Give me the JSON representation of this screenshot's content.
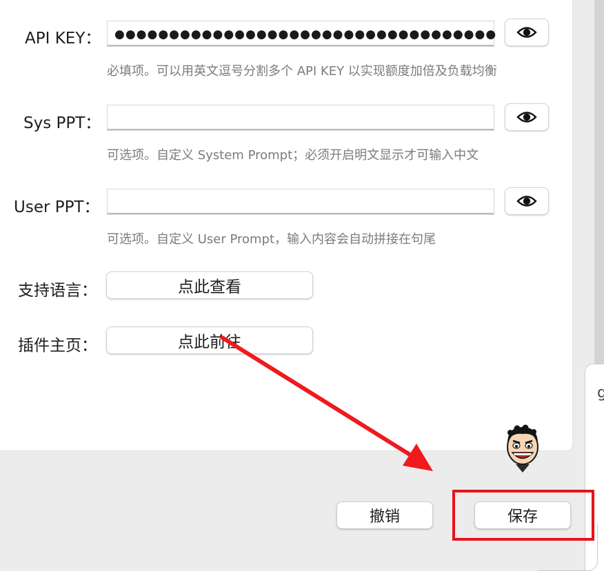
{
  "form": {
    "api_key": {
      "label": "API KEY：",
      "value": "●●●●●●●●●●●●●●●●●●●●●●●●●●●●●●●●●●●",
      "hint": "必填项。可以用英文逗号分割多个 API KEY 以实现额度加倍及负载均衡",
      "toggle_icon": "eye-icon"
    },
    "sys_ppt": {
      "label": "Sys PPT：",
      "value": "",
      "hint": "可选项。自定义 System Prompt；必须开启明文显示才可输入中文",
      "toggle_icon": "eye-icon"
    },
    "user_ppt": {
      "label": "User PPT：",
      "value": "",
      "hint": "可选项。自定义 User Prompt，输入内容会自动拼接在句尾",
      "toggle_icon": "eye-icon"
    },
    "languages": {
      "label": "支持语言：",
      "button": "点此查看"
    },
    "homepage": {
      "label": "插件主页：",
      "button": "点此前往"
    }
  },
  "footer": {
    "cancel_label": "撤销",
    "save_label": "保存"
  },
  "background": {
    "peek_text": "g"
  },
  "colors": {
    "highlight": "#e6141a",
    "arrow": "#ee1a1d",
    "panel": "#ffffff",
    "window_bg": "#ececec"
  },
  "decorations": {
    "mascot": "cartoon-face-icon"
  }
}
